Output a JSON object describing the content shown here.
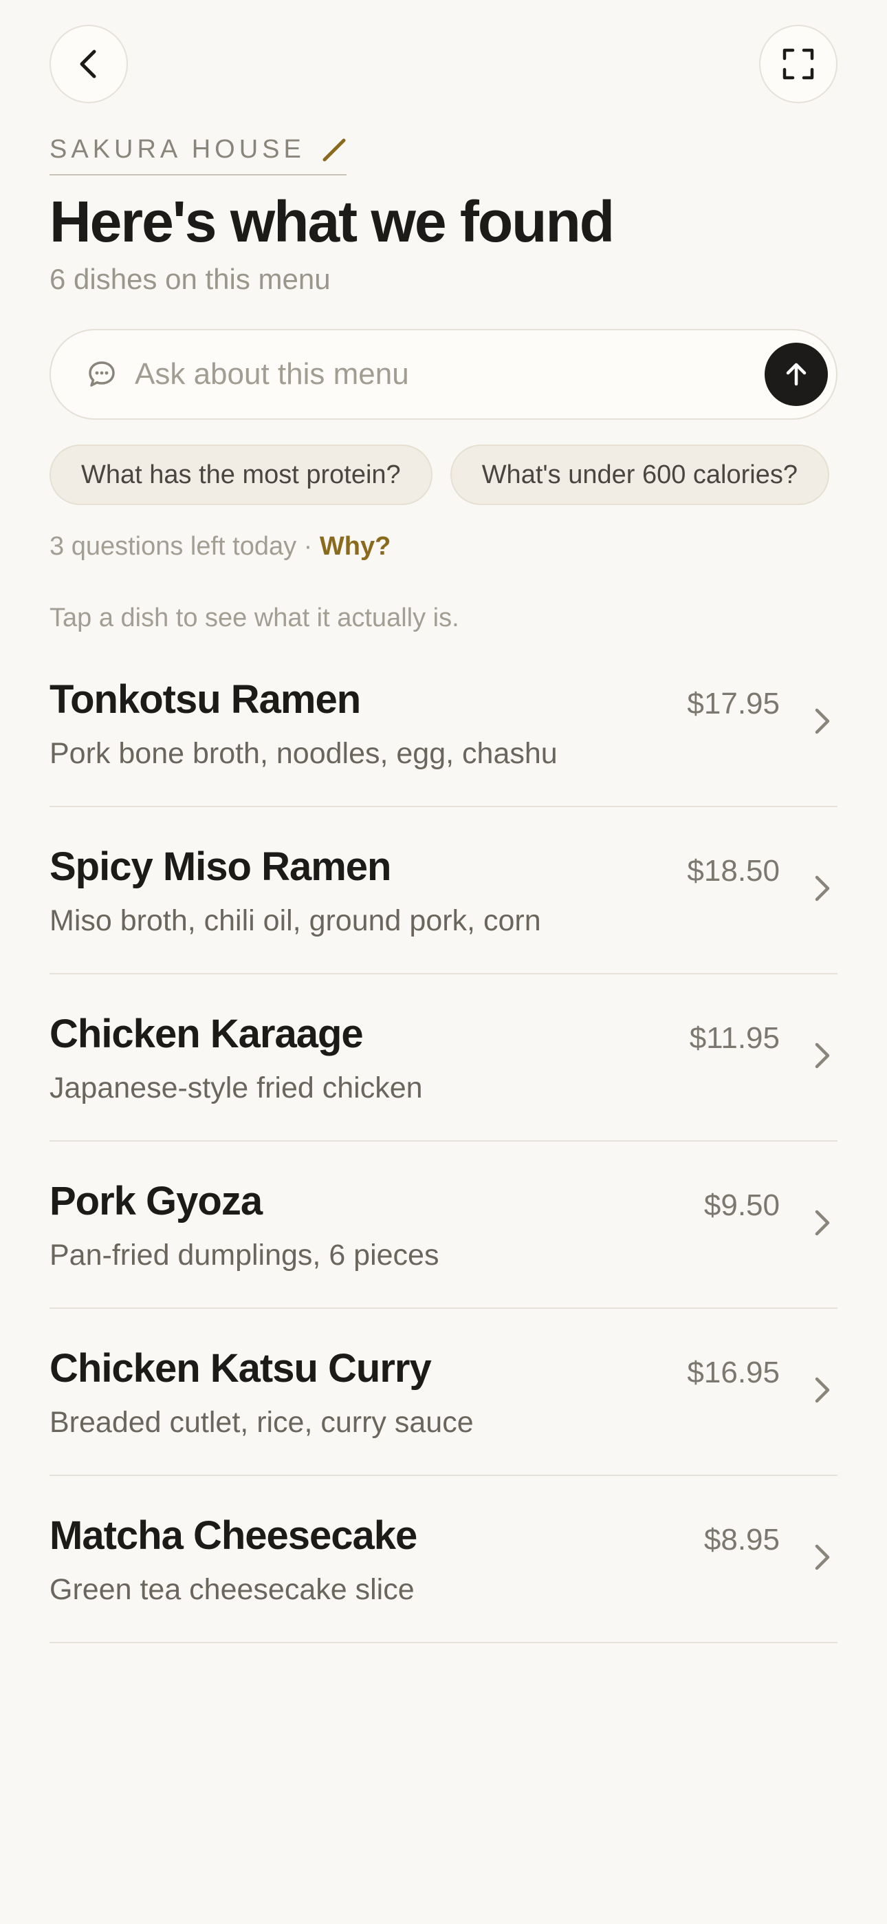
{
  "header": {
    "restaurant": "SAKURA HOUSE",
    "title": "Here's what we found",
    "subtitle": "6 dishes on this menu"
  },
  "ask": {
    "placeholder": "Ask about this menu"
  },
  "suggestions": [
    {
      "label": "What has the most protein?"
    },
    {
      "label": "What's under 600 calories?"
    }
  ],
  "quota": {
    "text": "3 questions left today · ",
    "link": "Why?"
  },
  "hint": "Tap a dish to see what it actually is.",
  "menu": [
    {
      "name": "Tonkotsu Ramen",
      "description": "Pork bone broth, noodles, egg, chashu",
      "price": "$17.95"
    },
    {
      "name": "Spicy Miso Ramen",
      "description": "Miso broth, chili oil, ground pork, corn",
      "price": "$18.50"
    },
    {
      "name": "Chicken Karaage",
      "description": "Japanese-style fried chicken",
      "price": "$11.95"
    },
    {
      "name": "Pork Gyoza",
      "description": "Pan-fried dumplings, 6 pieces",
      "price": "$9.50"
    },
    {
      "name": "Chicken Katsu Curry",
      "description": "Breaded cutlet, rice, curry sauce",
      "price": "$16.95"
    },
    {
      "name": "Matcha Cheesecake",
      "description": "Green tea cheesecake slice",
      "price": "$8.95"
    }
  ],
  "icons": {
    "back": "chevron-left-icon",
    "scan": "scan-frame-icon",
    "edit": "pencil-icon",
    "chat": "chat-bubble-icon",
    "send": "arrow-up-icon",
    "row": "chevron-right-icon"
  },
  "colors": {
    "accent": "#8a6a1c",
    "text": "#1c1b19",
    "background": "#f9f8f5"
  }
}
